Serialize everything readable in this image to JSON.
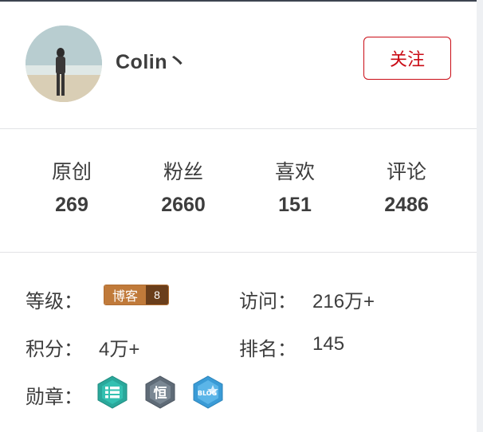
{
  "profile": {
    "username": "Colin丶",
    "follow_label": "关注"
  },
  "stats": [
    {
      "label": "原创",
      "value": "269"
    },
    {
      "label": "粉丝",
      "value": "2660"
    },
    {
      "label": "喜欢",
      "value": "151"
    },
    {
      "label": "评论",
      "value": "2486"
    }
  ],
  "info": {
    "level_label": "等级：",
    "level_badge_text": "博客",
    "level_badge_num": "8",
    "visits_label": "访问：",
    "visits_value": "216万+",
    "points_label": "积分：",
    "points_value": "4万+",
    "rank_label": "排名：",
    "rank_value": "145",
    "medals_label": "勋章："
  },
  "medals": [
    {
      "icon": "list-medal-icon",
      "text": "",
      "color": "#2aa89b"
    },
    {
      "icon": "persistence-medal-icon",
      "text": "恒",
      "color": "#5f6b77"
    },
    {
      "icon": "blog-star-medal-icon",
      "text": "BLOG",
      "color": "#3a9bd6"
    }
  ],
  "colors": {
    "accent": "#ca0c16",
    "text": "#3d3d3d",
    "level_badge": "#c07a3a"
  }
}
